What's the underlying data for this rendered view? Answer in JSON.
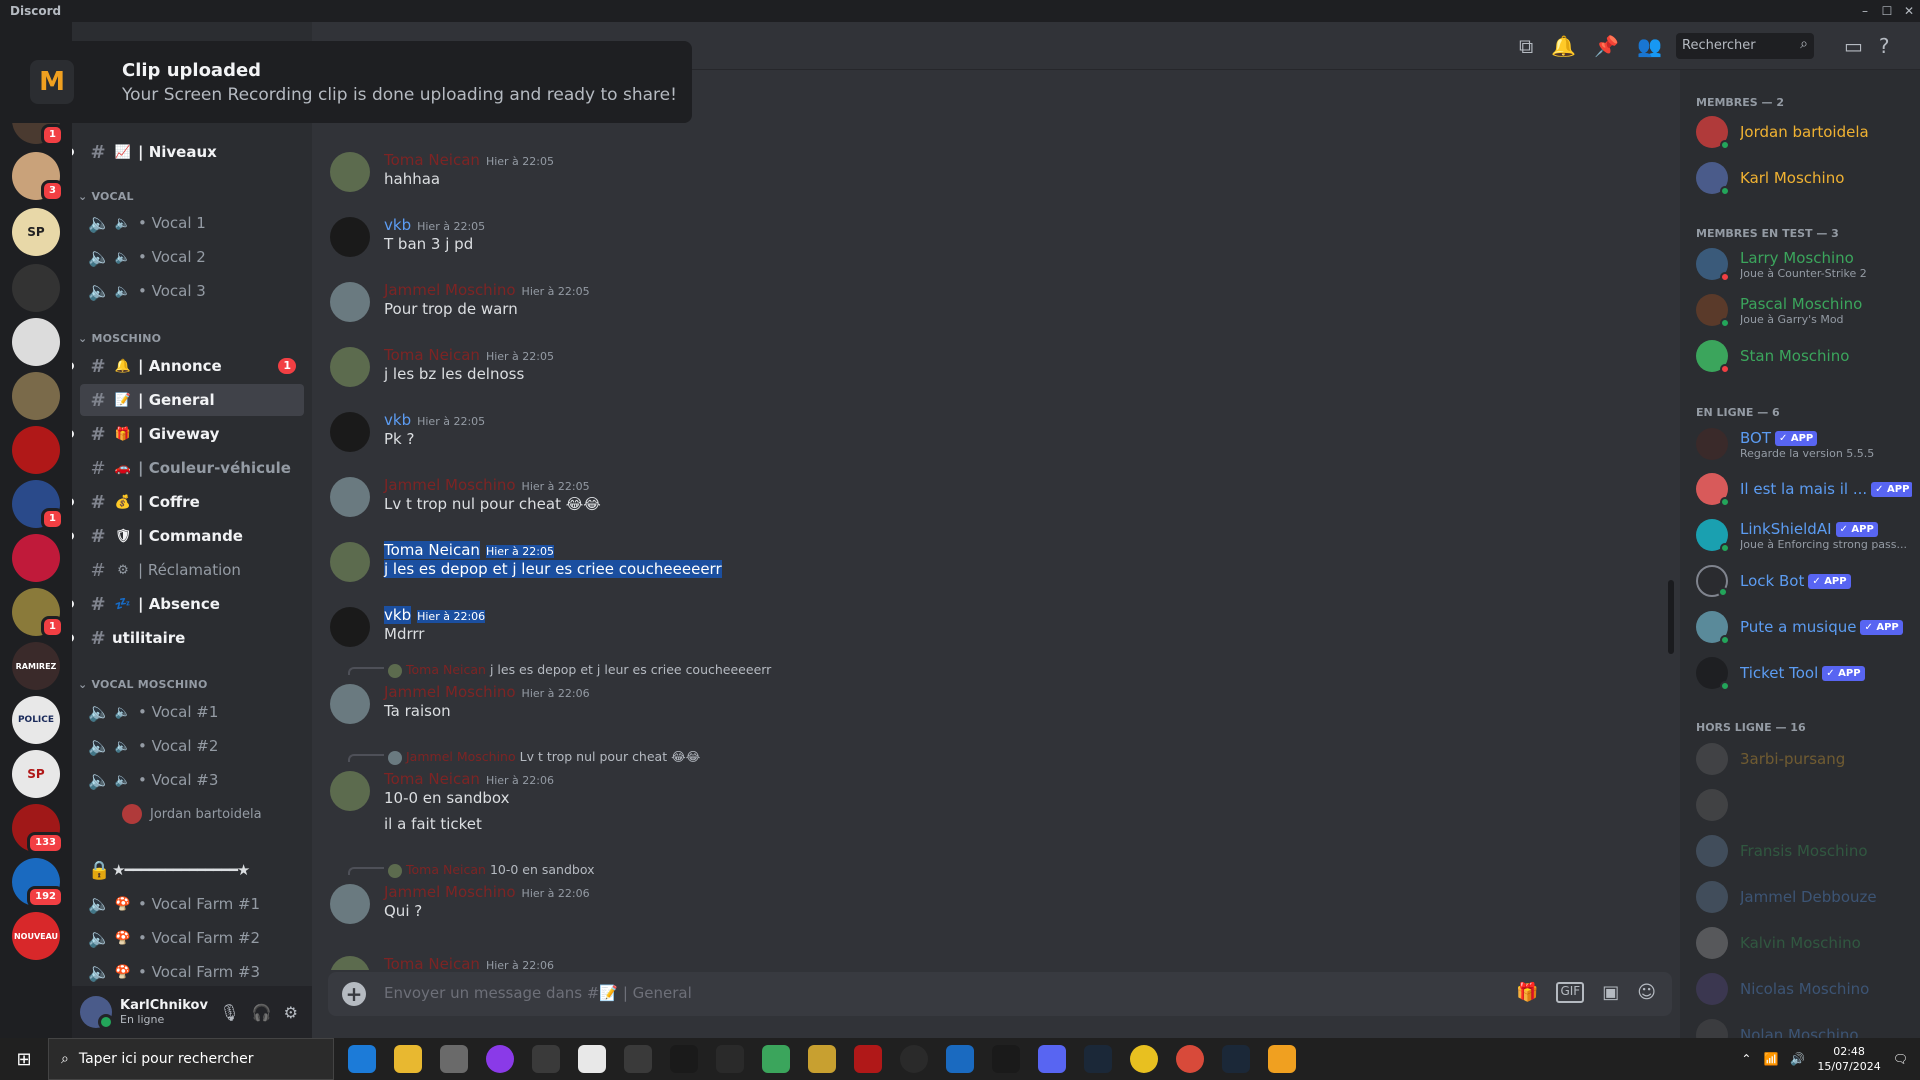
{
  "window": {
    "title": "Discord"
  },
  "toast": {
    "title": "Clip uploaded",
    "text": "Your Screen Recording clip is done uploading and ready to share!"
  },
  "servers": [
    {
      "label": "",
      "badge": "1"
    },
    {
      "label": "",
      "badge": "3"
    },
    {
      "label": "SP",
      "badge": ""
    },
    {
      "label": "",
      "badge": ""
    },
    {
      "label": "",
      "badge": ""
    },
    {
      "label": "",
      "badge": ""
    },
    {
      "label": "",
      "badge": ""
    },
    {
      "label": "",
      "badge": "1"
    },
    {
      "label": "",
      "badge": ""
    },
    {
      "label": "",
      "badge": "1"
    },
    {
      "label": "RAMIREZ",
      "badge": ""
    },
    {
      "label": "POLICE",
      "badge": ""
    },
    {
      "label": "SP",
      "badge": ""
    },
    {
      "label": "",
      "badge": "133"
    },
    {
      "label": "",
      "badge": "192"
    },
    {
      "label": "NOUVEAU",
      "badge": ""
    }
  ],
  "channels": {
    "top_channel": {
      "emoji": "📈",
      "name": "| Niveaux"
    },
    "cat_vocal": "VOCAL",
    "vocal": [
      "• Vocal 1",
      "• Vocal 2",
      "• Vocal 3"
    ],
    "cat_moschino": "MOSCHINO",
    "moschino": [
      {
        "emoji": "🔔",
        "name": "| Annonce",
        "count": "1"
      },
      {
        "emoji": "📝",
        "name": "| General",
        "count": ""
      },
      {
        "emoji": "🎁",
        "name": "| Giveway",
        "count": ""
      },
      {
        "emoji": "🚗",
        "name": "| Couleur-véhicule",
        "count": ""
      },
      {
        "emoji": "💰",
        "name": "| Coffre",
        "count": ""
      },
      {
        "emoji": "🛡",
        "name": "| Commande",
        "count": ""
      },
      {
        "emoji": "⚙",
        "name": "| Réclamation",
        "count": ""
      },
      {
        "emoji": "💤",
        "name": "| Absence",
        "count": ""
      }
    ],
    "utilitaire": "utilitaire",
    "cat_vocal_moschino": "VOCAL MOSCHINO",
    "vocal_moschino": [
      "• Vocal #1",
      "• Vocal #2",
      "• Vocal #3"
    ],
    "voice_user": "Jordan bartoidela",
    "separator": "★━━━━━━━━━━━━━━★",
    "farm": [
      "• Vocal Farm #1",
      "• Vocal Farm #2",
      "• Vocal Farm #3"
    ]
  },
  "user": {
    "name": "KarlChnikov",
    "status": "En ligne"
  },
  "search": {
    "placeholder": "Rechercher"
  },
  "messages": [
    {
      "author": "Toma Neican",
      "ts": "Hier à 22:05",
      "text": "hahhaa"
    },
    {
      "author": "vkb",
      "ts": "Hier à 22:05",
      "text": "T ban 3 j pd"
    },
    {
      "author": "Jammel Moschino",
      "ts": "Hier à 22:05",
      "text": "Pour trop de warn"
    },
    {
      "author": "Toma Neican",
      "ts": "Hier à 22:05",
      "text": "j les bz les delnoss"
    },
    {
      "author": "vkb",
      "ts": "Hier à 22:05",
      "text": "Pk ?"
    },
    {
      "author": "Jammel Moschino",
      "ts": "Hier à 22:05",
      "text": "Lv t trop nul pour cheat 😂😂"
    },
    {
      "author": "Toma Neican",
      "ts": "Hier à 22:05",
      "text": "j les es depop et j leur es criee coucheeeeerr"
    },
    {
      "author": "vkb",
      "ts": "Hier à 22:06",
      "text": "Mdrrr"
    },
    {
      "reply": "j les es depop et j leur es criee coucheeeeerr",
      "reply_author": "Toma Neican",
      "author": "Jammel Moschino",
      "ts": "Hier à 22:06",
      "text": "Ta raison"
    },
    {
      "reply": "Lv t trop nul pour cheat 😂😂",
      "reply_author": "Jammel Moschino",
      "author": "Toma Neican",
      "ts": "Hier à 22:06",
      "text": "10-0 en sandbox",
      "text2": "il a fait ticket"
    },
    {
      "reply": "10-0 en sandbox",
      "reply_author": "Toma Neican",
      "author": "Jammel Moschino",
      "ts": "Hier à 22:06",
      "text": "Qui ?"
    },
    {
      "author": "Toma Neican",
      "ts": "Hier à 22:06",
      "text": ""
    }
  ],
  "composer": {
    "placeholder": "Envoyer un message dans #📝 | General"
  },
  "members": {
    "sec1": "MEMBRES — 2",
    "m1": [
      {
        "name": "Jordan bartoidela",
        "activity": ""
      },
      {
        "name": "Karl Moschino",
        "activity": ""
      }
    ],
    "sec2": "MEMBRES EN TEST — 3",
    "m2": [
      {
        "name": "Larry Moschino",
        "activity": "Joue à Counter-Strike 2"
      },
      {
        "name": "Pascal Moschino",
        "activity": "Joue à Garry's Mod"
      },
      {
        "name": "Stan Moschino",
        "activity": ""
      }
    ],
    "sec3": "EN LIGNE — 6",
    "m3": [
      {
        "name": "BOT",
        "activity": "Regarde la version 5.5.5",
        "badge": "✓ APP"
      },
      {
        "name": "Il est la mais il ...",
        "activity": "",
        "badge": "✓ APP"
      },
      {
        "name": "LinkShieldAI",
        "activity": "Joue à Enforcing strong pass...",
        "badge": "✓ APP"
      },
      {
        "name": "Lock Bot",
        "activity": "",
        "badge": "✓ APP"
      },
      {
        "name": "Pute a musique",
        "activity": "",
        "badge": "✓ APP"
      },
      {
        "name": "Ticket Tool",
        "activity": "",
        "badge": "✓ APP"
      }
    ],
    "sec4": "HORS LIGNE — 16",
    "m4": [
      "3arbi-pursang",
      "",
      "Fransis Moschino",
      "Jammel Debbouze",
      "Kalvin Moschino",
      "Nicolas Moschino",
      "Nolan Moschino"
    ]
  },
  "taskbar": {
    "search": "Taper ici pour rechercher",
    "time": "02:48",
    "date": "15/07/2024"
  },
  "colors": {
    "accent": "#5865f2",
    "mention": "#f23f43",
    "online": "#23a55a",
    "highlight": "#1b4fa0"
  }
}
